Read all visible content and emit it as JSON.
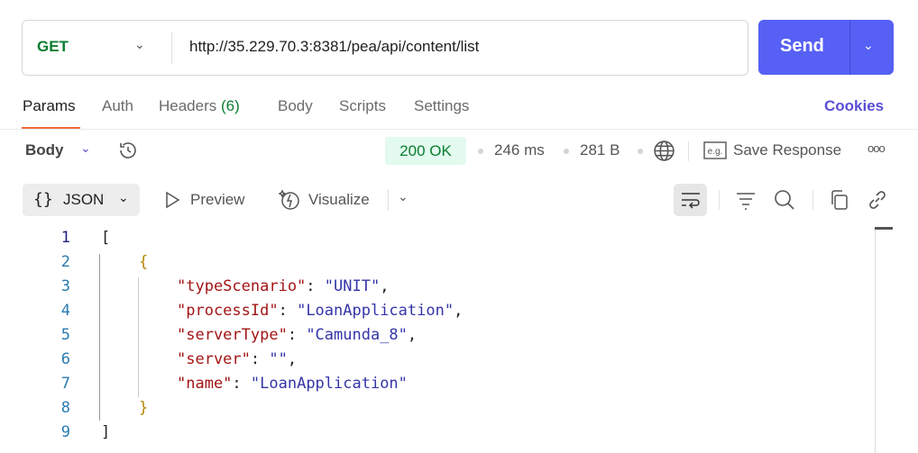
{
  "request": {
    "method": "GET",
    "url": "http://35.229.70.3:8381/pea/api/content/list",
    "send_label": "Send"
  },
  "tabs": [
    {
      "label": "Params"
    },
    {
      "label": "Auth"
    },
    {
      "label": "Headers",
      "count": "(6)"
    },
    {
      "label": "Body"
    },
    {
      "label": "Scripts"
    },
    {
      "label": "Settings"
    }
  ],
  "cookies_label": "Cookies",
  "response": {
    "section_label": "Body",
    "status": "200 OK",
    "time": "246 ms",
    "size": "281 B",
    "save_label": "Save Response",
    "status_color": "#0a7d32"
  },
  "toolbar": {
    "format": "JSON",
    "format_icon": "{}",
    "preview": "Preview",
    "visualize": "Visualize"
  },
  "code_lines": [
    {
      "n": "1",
      "indent": 0,
      "tokens": [
        {
          "t": "brk",
          "v": "["
        }
      ]
    },
    {
      "n": "2",
      "indent": 1,
      "tokens": [
        {
          "t": "brace",
          "v": "{"
        }
      ]
    },
    {
      "n": "3",
      "indent": 2,
      "tokens": [
        {
          "t": "key",
          "v": "\"typeScenario\""
        },
        {
          "t": "pun",
          "v": ": "
        },
        {
          "t": "str",
          "v": "\"UNIT\""
        },
        {
          "t": "pun",
          "v": ","
        }
      ]
    },
    {
      "n": "4",
      "indent": 2,
      "tokens": [
        {
          "t": "key",
          "v": "\"processId\""
        },
        {
          "t": "pun",
          "v": ": "
        },
        {
          "t": "str",
          "v": "\"LoanApplication\""
        },
        {
          "t": "pun",
          "v": ","
        }
      ]
    },
    {
      "n": "5",
      "indent": 2,
      "tokens": [
        {
          "t": "key",
          "v": "\"serverType\""
        },
        {
          "t": "pun",
          "v": ": "
        },
        {
          "t": "str",
          "v": "\"Camunda_8\""
        },
        {
          "t": "pun",
          "v": ","
        }
      ]
    },
    {
      "n": "6",
      "indent": 2,
      "tokens": [
        {
          "t": "key",
          "v": "\"server\""
        },
        {
          "t": "pun",
          "v": ": "
        },
        {
          "t": "str",
          "v": "\"\""
        },
        {
          "t": "pun",
          "v": ","
        }
      ]
    },
    {
      "n": "7",
      "indent": 2,
      "tokens": [
        {
          "t": "key",
          "v": "\"name\""
        },
        {
          "t": "pun",
          "v": ": "
        },
        {
          "t": "str",
          "v": "\"LoanApplication\""
        }
      ]
    },
    {
      "n": "8",
      "indent": 1,
      "tokens": [
        {
          "t": "brace",
          "v": "}"
        }
      ]
    },
    {
      "n": "9",
      "indent": 0,
      "tokens": [
        {
          "t": "brk",
          "v": "]"
        }
      ]
    }
  ]
}
